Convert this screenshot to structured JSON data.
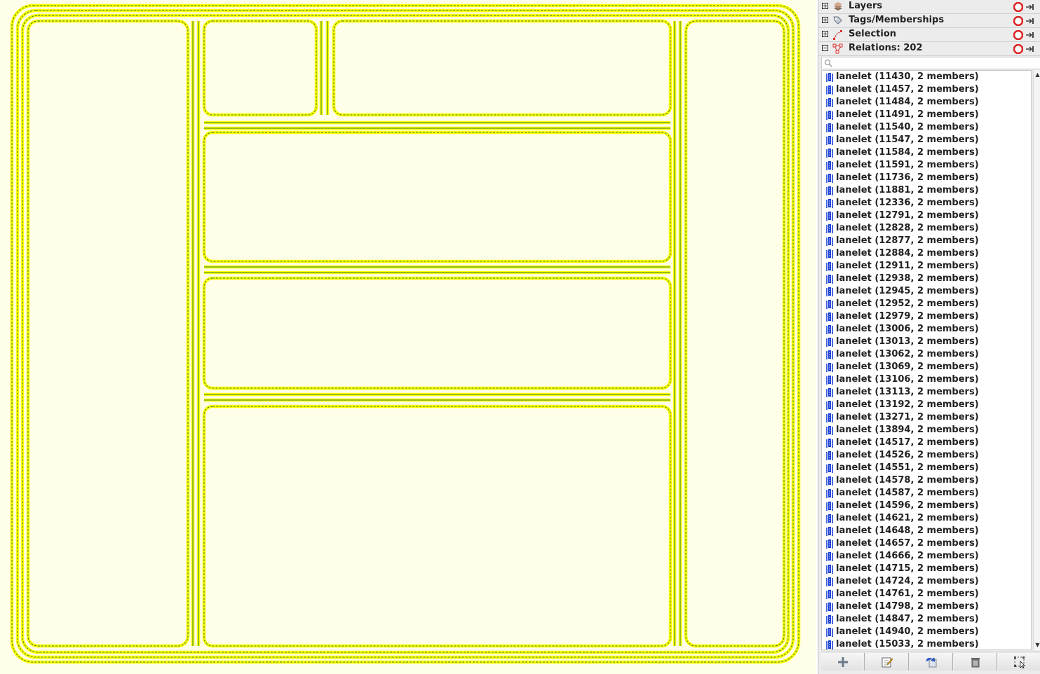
{
  "sidebar": {
    "panels": [
      {
        "title": "Layers",
        "icon": "layers-icon",
        "expanded": false
      },
      {
        "title": "Tags/Memberships",
        "icon": "tag-icon",
        "expanded": false
      },
      {
        "title": "Selection",
        "icon": "selection-icon",
        "expanded": false
      },
      {
        "title": "Relations: 202",
        "icon": "relations-icon",
        "expanded": true
      }
    ],
    "search": {
      "value": "",
      "placeholder": ""
    },
    "relations": [
      "lanelet (11430, 2 members)",
      "lanelet (11457, 2 members)",
      "lanelet (11484, 2 members)",
      "lanelet (11491, 2 members)",
      "lanelet (11540, 2 members)",
      "lanelet (11547, 2 members)",
      "lanelet (11584, 2 members)",
      "lanelet (11591, 2 members)",
      "lanelet (11736, 2 members)",
      "lanelet (11881, 2 members)",
      "lanelet (12336, 2 members)",
      "lanelet (12791, 2 members)",
      "lanelet (12828, 2 members)",
      "lanelet (12877, 2 members)",
      "lanelet (12884, 2 members)",
      "lanelet (12911, 2 members)",
      "lanelet (12938, 2 members)",
      "lanelet (12945, 2 members)",
      "lanelet (12952, 2 members)",
      "lanelet (12979, 2 members)",
      "lanelet (13006, 2 members)",
      "lanelet (13013, 2 members)",
      "lanelet (13062, 2 members)",
      "lanelet (13069, 2 members)",
      "lanelet (13106, 2 members)",
      "lanelet (13113, 2 members)",
      "lanelet (13192, 2 members)",
      "lanelet (13271, 2 members)",
      "lanelet (13894, 2 members)",
      "lanelet (14517, 2 members)",
      "lanelet (14526, 2 members)",
      "lanelet (14551, 2 members)",
      "lanelet (14578, 2 members)",
      "lanelet (14587, 2 members)",
      "lanelet (14596, 2 members)",
      "lanelet (14621, 2 members)",
      "lanelet (14648, 2 members)",
      "lanelet (14657, 2 members)",
      "lanelet (14666, 2 members)",
      "lanelet (14715, 2 members)",
      "lanelet (14724, 2 members)",
      "lanelet (14761, 2 members)",
      "lanelet (14798, 2 members)",
      "lanelet (14847, 2 members)",
      "lanelet (14940, 2 members)",
      "lanelet (15033, 2 members)"
    ],
    "toolbar_buttons": [
      "add-icon",
      "edit-icon",
      "duplicate-icon",
      "delete-icon",
      "select-members-icon"
    ]
  },
  "colors": {
    "map_background": "#fffee8",
    "way_highlight": "#ffff00",
    "way_core": "#2e7d32",
    "relation_icon": "#1a3fd6"
  }
}
